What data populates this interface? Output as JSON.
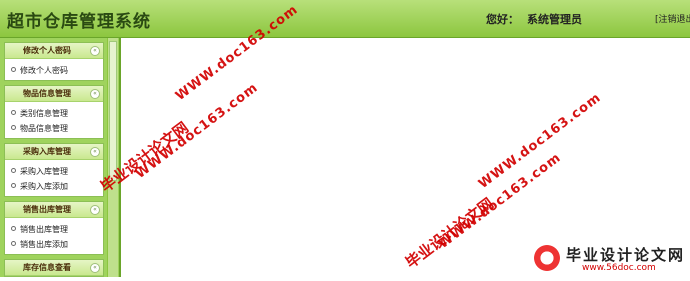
{
  "header": {
    "title": "超市仓库管理系统",
    "greeting": "您好：",
    "username": "系统管理员",
    "logout": "[注销退出"
  },
  "sidebar": {
    "groups": [
      {
        "title": "修改个人密码",
        "items": [
          "修改个人密码"
        ]
      },
      {
        "title": "物品信息管理",
        "items": [
          "类别信息管理",
          "物品信息管理"
        ]
      },
      {
        "title": "采购入库管理",
        "items": [
          "采购入库管理",
          "采购入库添加"
        ]
      },
      {
        "title": "销售出库管理",
        "items": [
          "销售出库管理",
          "销售出库添加"
        ]
      },
      {
        "title": "库存信息查看",
        "items": []
      }
    ],
    "toggle_glyph": "«"
  },
  "watermarks": {
    "cn": "毕业设计论文网",
    "url": "WWW.doc163.com",
    "logo_text": "毕业设计论文网",
    "logo_url": "www.56doc.com"
  }
}
